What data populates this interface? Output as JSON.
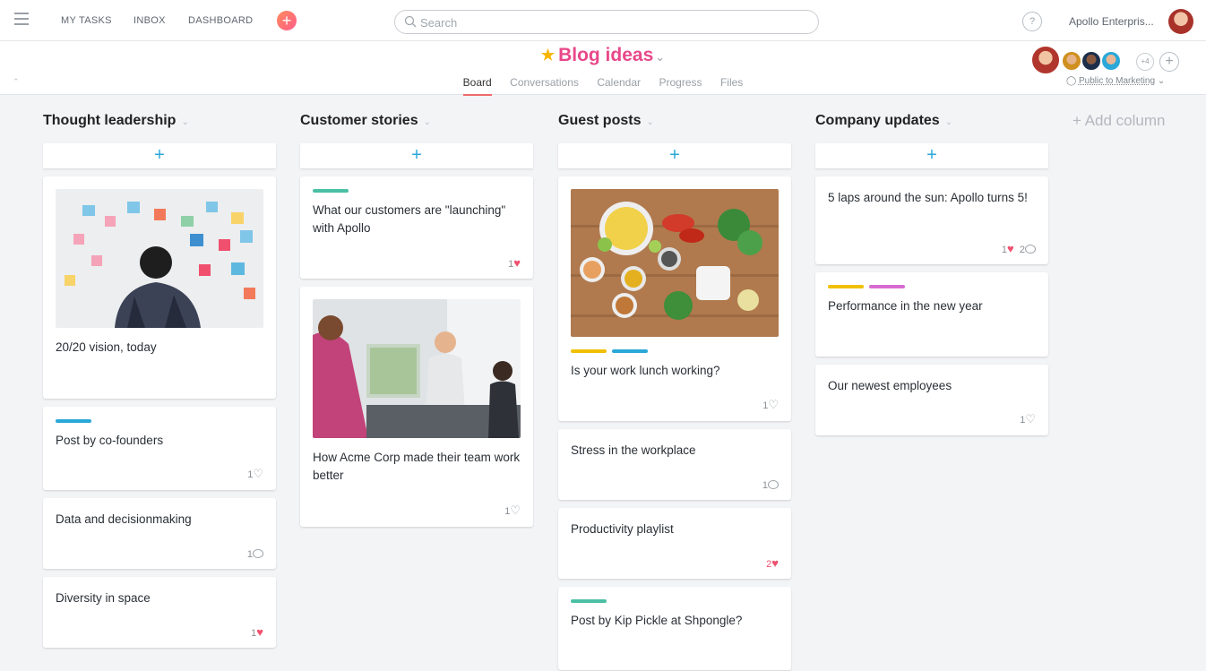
{
  "topbar": {
    "nav": [
      "MY TASKS",
      "INBOX",
      "DASHBOARD"
    ],
    "search_placeholder": "Search",
    "help": "?",
    "org_name": "Apollo Enterpris..."
  },
  "project": {
    "title": "Blog ideas",
    "tabs": [
      "Board",
      "Conversations",
      "Calendar",
      "Progress",
      "Files"
    ],
    "active_tab": "Board",
    "extra_members": "+4",
    "privacy": "Public to Marketing"
  },
  "colors": {
    "accent": "#e8488a",
    "tag_teal": "#4bc0a5",
    "tag_blue": "#2aa8d8",
    "tag_yellow": "#f0c000",
    "tag_pink": "#d86bd0",
    "heart": "#f0506e"
  },
  "columns": [
    {
      "title": "Thought leadership",
      "cards": [
        {
          "title": "20/20 vision, today",
          "image": "sticky-notes-photo"
        },
        {
          "title": "Post by co-founders",
          "tags": [
            "blue"
          ],
          "likes": "1",
          "liked": false
        },
        {
          "title": "Data and decisionmaking",
          "comments": "1"
        },
        {
          "title": "Diversity in space",
          "likes": "1",
          "liked": true
        }
      ]
    },
    {
      "title": "Customer stories",
      "cards": [
        {
          "title": "What our customers are \"launching\" with Apollo",
          "tags": [
            "teal"
          ],
          "likes": "1",
          "liked": true
        },
        {
          "title": "How Acme Corp made their team work better",
          "image": "office-meeting-photo",
          "likes": "1",
          "liked": false
        }
      ]
    },
    {
      "title": "Guest posts",
      "cards": [
        {
          "title": "Is your work lunch working?",
          "image": "food-ingredients-photo",
          "tags": [
            "yellow",
            "blue"
          ],
          "likes": "1",
          "liked": false
        },
        {
          "title": "Stress in the workplace",
          "comments": "1"
        },
        {
          "title": "Productivity playlist",
          "likes": "2",
          "liked": true
        },
        {
          "title": "Post by Kip Pickle at Shpongle?",
          "tags": [
            "teal"
          ]
        }
      ]
    },
    {
      "title": "Company updates",
      "cards": [
        {
          "title": "5 laps around the sun: Apollo turns 5!",
          "likes": "1",
          "liked": true,
          "comments": "2"
        },
        {
          "title": "Performance in the new year",
          "tags": [
            "yellow",
            "pink"
          ]
        },
        {
          "title": "Our newest employees",
          "likes": "1",
          "liked": false
        }
      ]
    }
  ],
  "add_column": "+ Add column"
}
